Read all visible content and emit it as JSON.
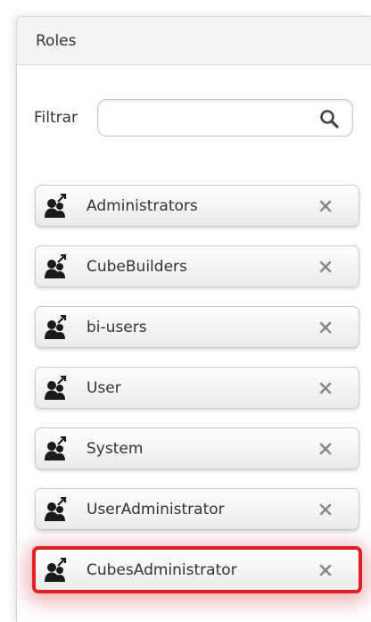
{
  "header": {
    "title": "Roles"
  },
  "filter": {
    "label": "Filtrar",
    "value": "",
    "icon": "search-icon"
  },
  "roles": [
    {
      "label": "Administrators",
      "selected": false
    },
    {
      "label": "CubeBuilders",
      "selected": false
    },
    {
      "label": "bi-users",
      "selected": false
    },
    {
      "label": "User",
      "selected": false
    },
    {
      "label": "System",
      "selected": false
    },
    {
      "label": "UserAdministrator",
      "selected": false
    },
    {
      "label": "CubesAdministrator",
      "selected": true
    }
  ],
  "icons": {
    "role": "role-users-icon",
    "remove": "remove-icon"
  },
  "colors": {
    "highlight": "#e02228"
  }
}
